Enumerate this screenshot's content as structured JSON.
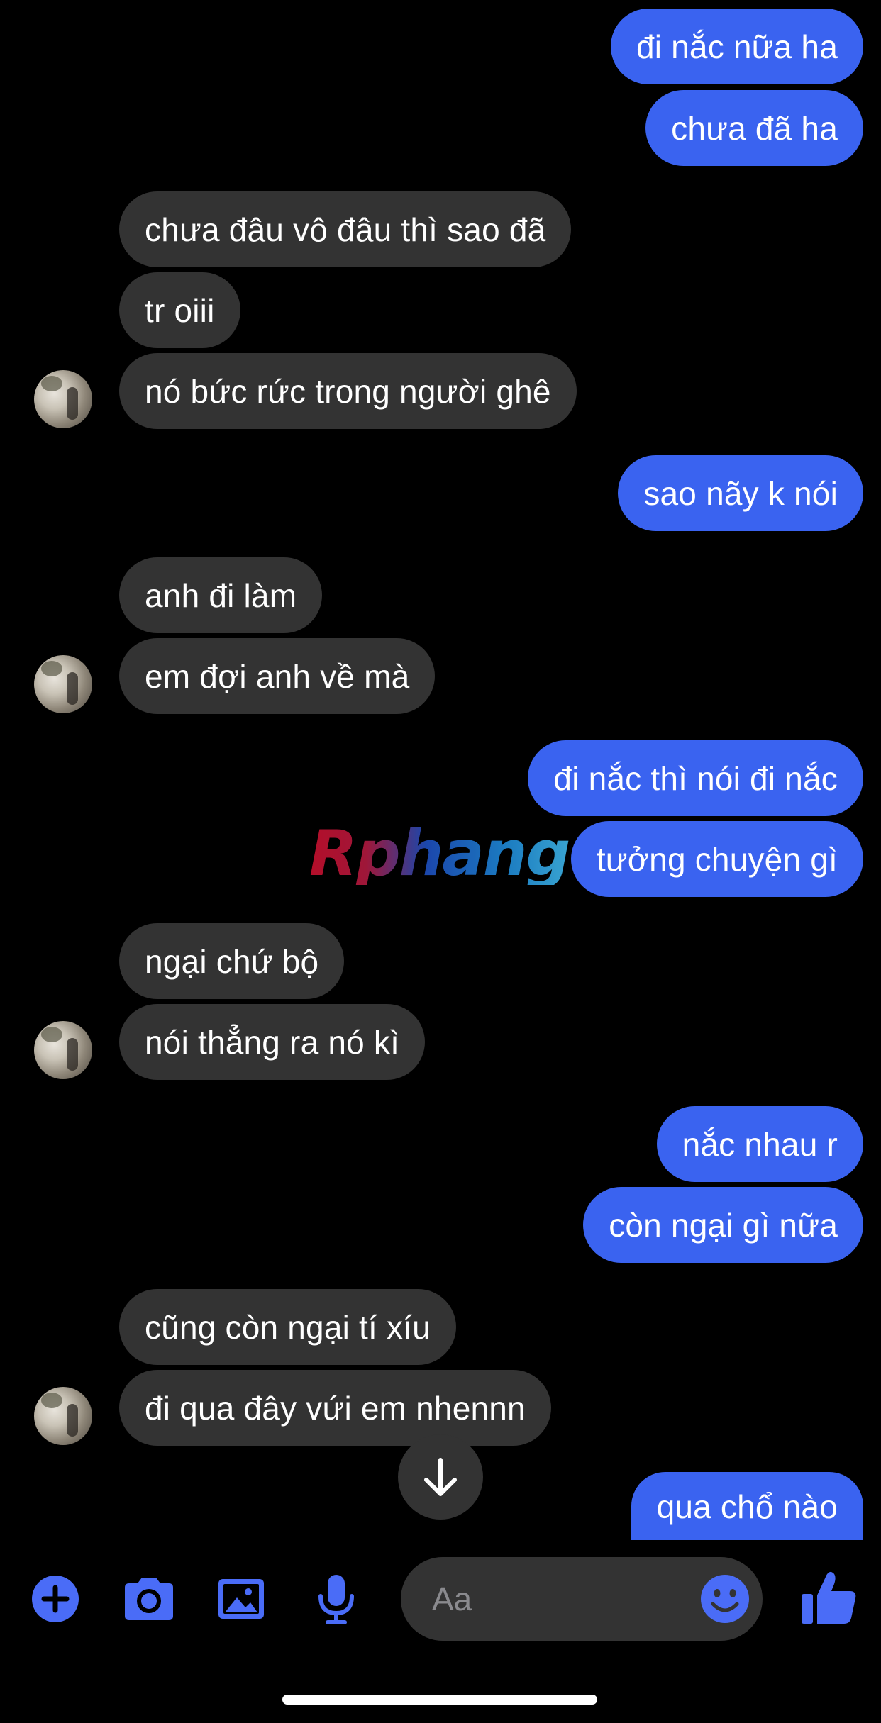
{
  "theme": {
    "sent_bubble_color": "#3a63f0",
    "received_bubble_color": "#333333",
    "background_color": "#000000",
    "accent_color": "#4a6cf7"
  },
  "messages": [
    {
      "side": "sent",
      "text": "đi nắc nữa ha"
    },
    {
      "side": "sent",
      "text": "chưa đã ha"
    },
    {
      "side": "received",
      "text": "chưa đâu vô đâu thì sao đã"
    },
    {
      "side": "received",
      "text": "tr oiii"
    },
    {
      "side": "received",
      "text": "nó bức rức trong người ghê"
    },
    {
      "side": "sent",
      "text": "sao nãy k nói"
    },
    {
      "side": "received",
      "text": "anh đi làm"
    },
    {
      "side": "received",
      "text": "em đợi anh về mà"
    },
    {
      "side": "sent",
      "text": "đi nắc thì nói đi nắc"
    },
    {
      "side": "sent",
      "text": "tưởng chuyện gì"
    },
    {
      "side": "received",
      "text": "ngại chứ bộ"
    },
    {
      "side": "received",
      "text": "nói thẳng ra nó kì"
    },
    {
      "side": "sent",
      "text": "nắc nhau r"
    },
    {
      "side": "sent",
      "text": "còn ngại gì nữa"
    },
    {
      "side": "received",
      "text": "cũng còn ngại tí xíu"
    },
    {
      "side": "received",
      "text": "đi qua đây vứi em nhennn"
    },
    {
      "side": "sent",
      "text": "qua chổ nào"
    }
  ],
  "watermark": {
    "text": "Rphang"
  },
  "composer": {
    "input_placeholder": "Aa",
    "icons": [
      "plus-icon",
      "camera-icon",
      "image-icon",
      "microphone-icon",
      "emoji-icon",
      "thumbs-up-icon"
    ]
  }
}
